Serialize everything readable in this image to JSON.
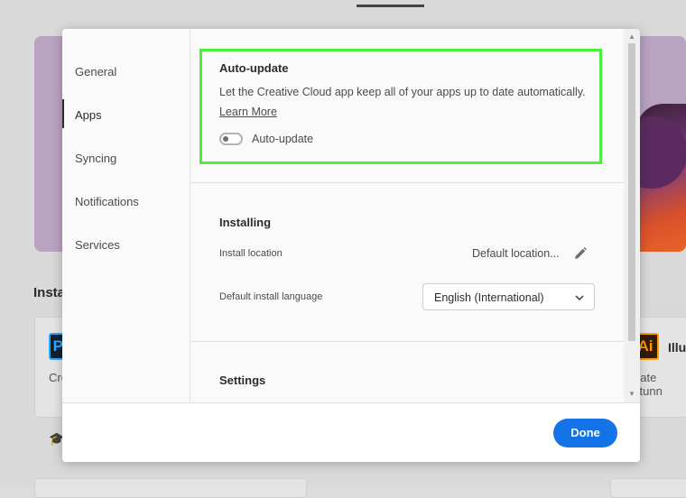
{
  "background": {
    "section_heading": "Insta",
    "card_left_text": "Cre",
    "card_right_text": "eate stunn",
    "app_right_name": "Illu",
    "app_left_icon": "Ps",
    "app_right_icon": "Ai"
  },
  "sidebar": {
    "items": [
      {
        "label": "General"
      },
      {
        "label": "Apps"
      },
      {
        "label": "Syncing"
      },
      {
        "label": "Notifications"
      },
      {
        "label": "Services"
      }
    ],
    "active_index": 1
  },
  "auto_update": {
    "title": "Auto-update",
    "description": "Let the Creative Cloud app keep all of your apps up to date automatically.",
    "learn_more": "Learn More",
    "toggle_label": "Auto-update",
    "toggle_on": false
  },
  "installing": {
    "title": "Installing",
    "install_location_label": "Install location",
    "install_location_value": "Default location...",
    "language_label": "Default install language",
    "language_value": "English (International)"
  },
  "settings": {
    "title": "Settings"
  },
  "footer": {
    "done_label": "Done"
  },
  "colors": {
    "accent": "#1473e6",
    "highlight": "#4cf03c"
  }
}
